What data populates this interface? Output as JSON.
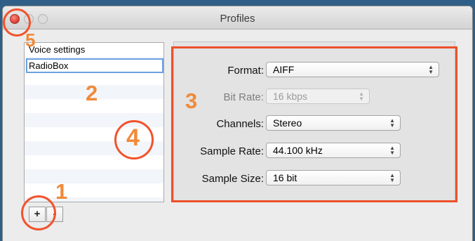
{
  "window": {
    "title": "Profiles"
  },
  "profile_list": {
    "items": [
      {
        "label": "Voice settings"
      }
    ],
    "editing_value": "RadioBox"
  },
  "list_buttons": {
    "add": "+",
    "remove": "-"
  },
  "settings": {
    "format": {
      "label": "Format:",
      "value": "AIFF",
      "enabled": true
    },
    "bit_rate": {
      "label": "Bit Rate:",
      "value": "16 kbps",
      "enabled": false
    },
    "channels": {
      "label": "Channels:",
      "value": "Stereo",
      "enabled": true
    },
    "sample_rate": {
      "label": "Sample Rate:",
      "value": "44.100 kHz",
      "enabled": true
    },
    "sample_size": {
      "label": "Sample Size:",
      "value": "16 bit",
      "enabled": true
    }
  },
  "annotations": {
    "n1": "1",
    "n2": "2",
    "n3": "3",
    "n4": "4",
    "n5": "5"
  },
  "colors": {
    "annotation_circle": "#f2532c",
    "annotation_number": "#f08a3a"
  },
  "icons": {
    "popup_arrows": "updown-arrows-icon"
  }
}
